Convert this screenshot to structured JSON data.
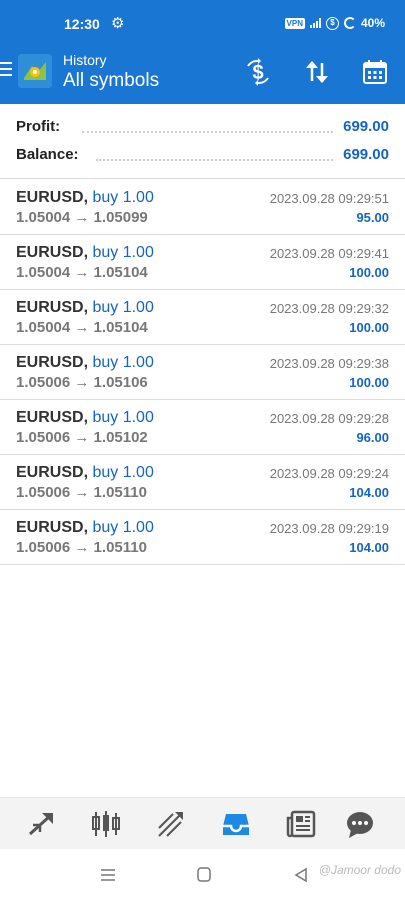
{
  "status_bar": {
    "time": "12:30",
    "vpn": "VPN",
    "battery": "40%"
  },
  "app_bar": {
    "section": "History",
    "filter": "All symbols",
    "actions": [
      "dollar-sync-icon",
      "sort-icon",
      "calendar-icon"
    ]
  },
  "summary": {
    "profit_label": "Profit:",
    "profit_value": "699.00",
    "balance_label": "Balance:",
    "balance_value": "699.00"
  },
  "deals": [
    {
      "symbol": "EURUSD,",
      "side": "buy 1.00",
      "prices": "1.05004 → 1.05099",
      "time": "2023.09.28 09:29:51",
      "profit": "95.00"
    },
    {
      "symbol": "EURUSD,",
      "side": "buy 1.00",
      "prices": "1.05004 → 1.05104",
      "time": "2023.09.28 09:29:41",
      "profit": "100.00"
    },
    {
      "symbol": "EURUSD,",
      "side": "buy 1.00",
      "prices": "1.05004 → 1.05104",
      "time": "2023.09.28 09:29:32",
      "profit": "100.00"
    },
    {
      "symbol": "EURUSD,",
      "side": "buy 1.00",
      "prices": "1.05006 → 1.05106",
      "time": "2023.09.28 09:29:38",
      "profit": "100.00"
    },
    {
      "symbol": "EURUSD,",
      "side": "buy 1.00",
      "prices": "1.05006 → 1.05102",
      "time": "2023.09.28 09:29:28",
      "profit": "96.00"
    },
    {
      "symbol": "EURUSD,",
      "side": "buy 1.00",
      "prices": "1.05006 → 1.05110",
      "time": "2023.09.28 09:29:24",
      "profit": "104.00"
    },
    {
      "symbol": "EURUSD,",
      "side": "buy 1.00",
      "prices": "1.05006 → 1.05110",
      "time": "2023.09.28 09:29:19",
      "profit": "104.00"
    }
  ],
  "bottom_tabs": [
    {
      "icon": "quotes-icon",
      "active": false
    },
    {
      "icon": "chart-icon",
      "active": false
    },
    {
      "icon": "trade-icon",
      "active": false
    },
    {
      "icon": "history-icon",
      "active": true
    },
    {
      "icon": "news-icon",
      "active": false
    },
    {
      "icon": "messages-icon",
      "active": false
    }
  ],
  "colors": {
    "brand": "#1976d2",
    "value_blue": "#1565c0",
    "tab_active": "#1e88e5",
    "tab_inactive": "#555555"
  },
  "watermark": "@Jamoor dodo"
}
